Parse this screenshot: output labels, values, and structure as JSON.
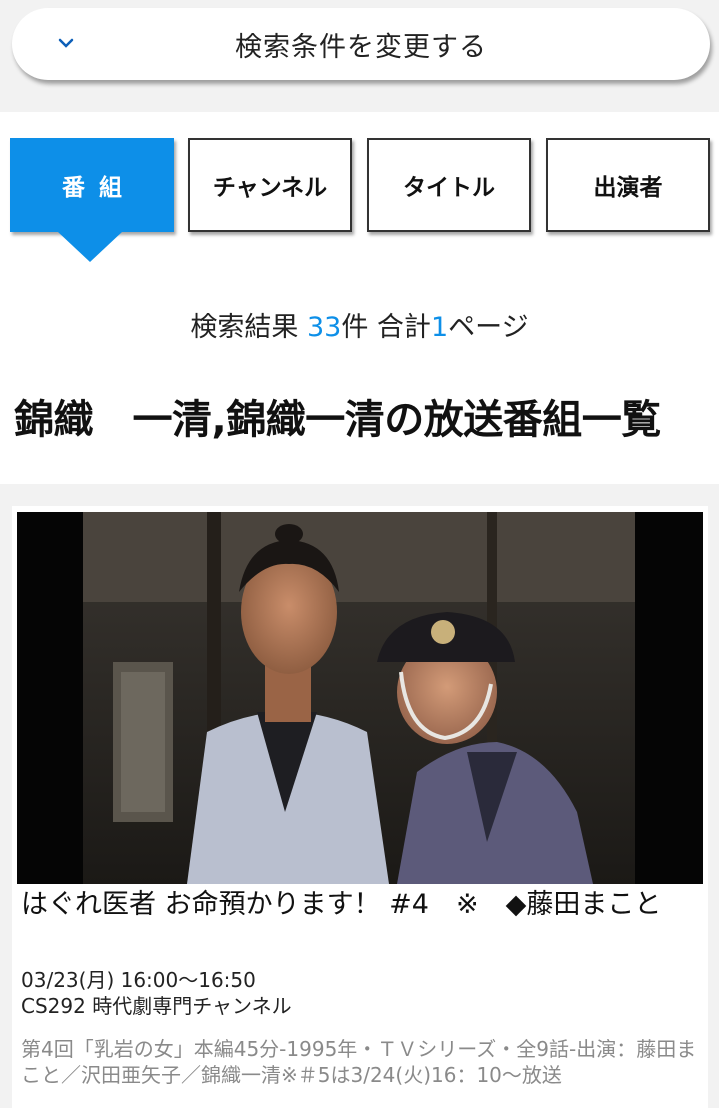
{
  "search_bar": {
    "label": "検索条件を変更する",
    "icon": "chevron-down-icon"
  },
  "tabs": [
    {
      "label": "番組",
      "active": true
    },
    {
      "label": "チャンネル",
      "active": false
    },
    {
      "label": "タイトル",
      "active": false
    },
    {
      "label": "出演者",
      "active": false
    }
  ],
  "results": {
    "prefix": "検索結果 ",
    "count": "33",
    "count_suffix": "件 合計",
    "pages": "1",
    "pages_suffix": "ページ"
  },
  "heading": "錦織　一清,錦織一清の放送番組一覧",
  "program": {
    "title": "はぐれ医者 お命預かります！ #4　※　◆藤田まこと",
    "time": "03/23(月) 16:00〜16:50",
    "channel": "CS292 時代劇専門チャンネル",
    "description": "第4回「乳岩の女」本編45分-1995年・ＴＶシリーズ・全9話-出演：藤田まこと／沢田亜矢子／錦織一清※＃5は3/24(火)16：10〜放送"
  },
  "colors": {
    "accent": "#0d8fe8",
    "muted_text": "#8a8a8a",
    "page_bg": "#f2f2f2"
  }
}
